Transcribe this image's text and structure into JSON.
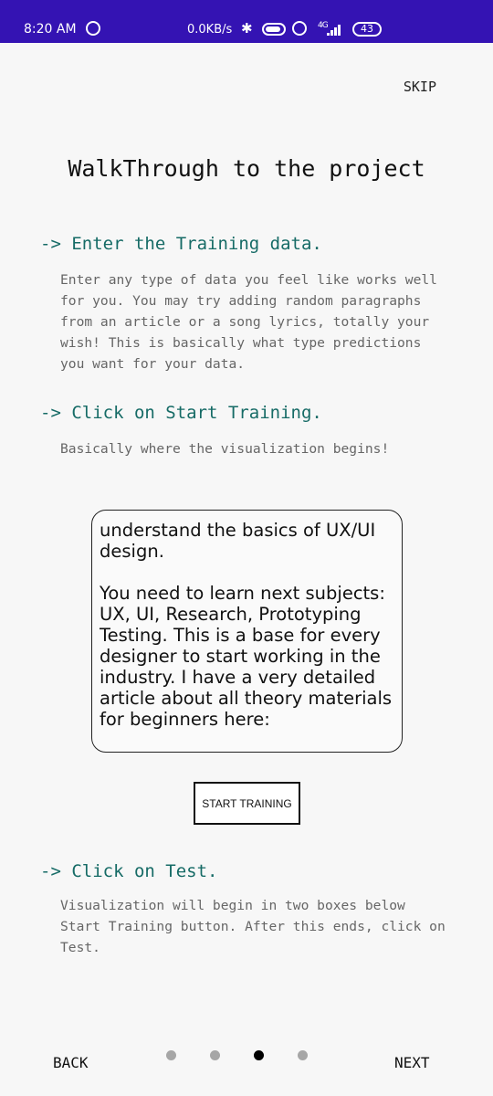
{
  "status_bar": {
    "time": "8:20 AM",
    "network_speed": "0.0KB/s",
    "signal_label": "4G",
    "battery": "43"
  },
  "skip_label": "SKIP",
  "title": "WalkThrough to the project",
  "steps": [
    {
      "title": "-> Enter the Training data.",
      "text": "Enter any type of data you feel like works well for you. You may try adding random paragraphs from an article or a song lyrics, totally your wish! This is basically what type predictions you want for your data."
    },
    {
      "title": "-> Click on Start Training.",
      "text": "Basically where the visualization begins!"
    },
    {
      "title": "-> Click on Test.",
      "text": "Visualization will begin in two boxes below Start Training button. After this ends, click on Test."
    }
  ],
  "training_input": {
    "value": "understand the basics of UX/UI design.\n\nYou need to learn next subjects: UX, UI, Research, Prototyping Testing. This is a base for every designer to start working in the industry. I have a very detailed article about all theory materials for beginners here:"
  },
  "start_button_label": "START TRAINING",
  "nav": {
    "back_label": "BACK",
    "next_label": "NEXT",
    "page_count": 4,
    "active_page": 3
  },
  "colors": {
    "status_bar": "#3413b3",
    "step_title": "#166b66",
    "body_text": "#666666",
    "background": "#f7f7f7"
  }
}
